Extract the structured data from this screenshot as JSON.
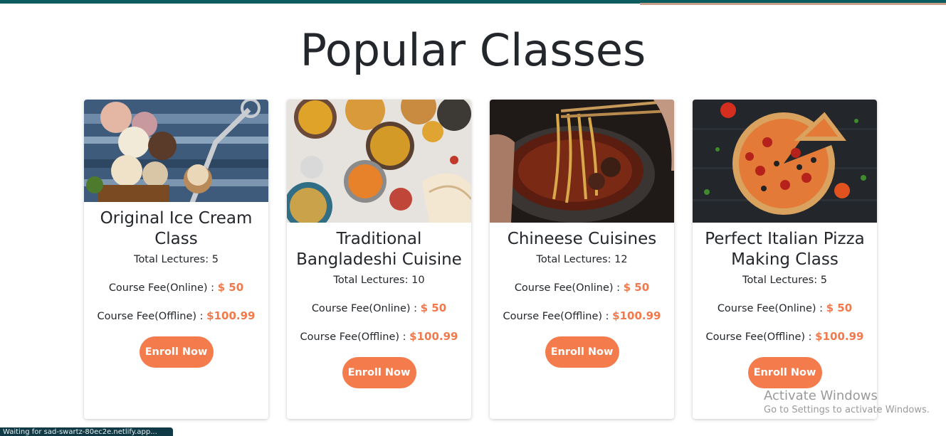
{
  "page": {
    "title": "Popular Classes"
  },
  "theme": {
    "accent": "#f47b4c",
    "price_color": "#f2794b",
    "top_bar": "#0b5c5e",
    "top_bar_accent": "#c49e88"
  },
  "cards": [
    {
      "title": "Original Ice Cream Class",
      "image_icon": "ice-cream-image",
      "lectures": "Total Lectures: 5",
      "online_label": "Course Fee(Online) :",
      "online_price": "$ 50",
      "offline_label": "Course Fee(Offline) :",
      "offline_price": "$100.99",
      "button": "Enroll Now"
    },
    {
      "title": "Traditional Bangladeshi Cuisine",
      "image_icon": "curry-dishes-image",
      "lectures": "Total Lectures: 10",
      "online_label": "Course Fee(Online) :",
      "online_price": "$ 50",
      "offline_label": "Course Fee(Offline) :",
      "offline_price": "$100.99",
      "button": "Enroll Now"
    },
    {
      "title": "Chineese Cuisines",
      "image_icon": "noodle-bowl-image",
      "lectures": "Total Lectures: 12",
      "online_label": "Course Fee(Online) :",
      "online_price": "$ 50",
      "offline_label": "Course Fee(Offline) :",
      "offline_price": "$100.99",
      "button": "Enroll Now"
    },
    {
      "title": "Perfect Italian Pizza Making Class",
      "image_icon": "pizza-image",
      "lectures": "Total Lectures: 5",
      "online_label": "Course Fee(Online) :",
      "online_price": "$ 50",
      "offline_label": "Course Fee(Offline) :",
      "offline_price": "$100.99",
      "button": "Enroll Now"
    }
  ],
  "status_bar": {
    "text": "Waiting for sad-swartz-80ec2e.netlify.app..."
  },
  "watermark": {
    "title": "Activate Windows",
    "subtitle": "Go to Settings to activate Windows."
  }
}
